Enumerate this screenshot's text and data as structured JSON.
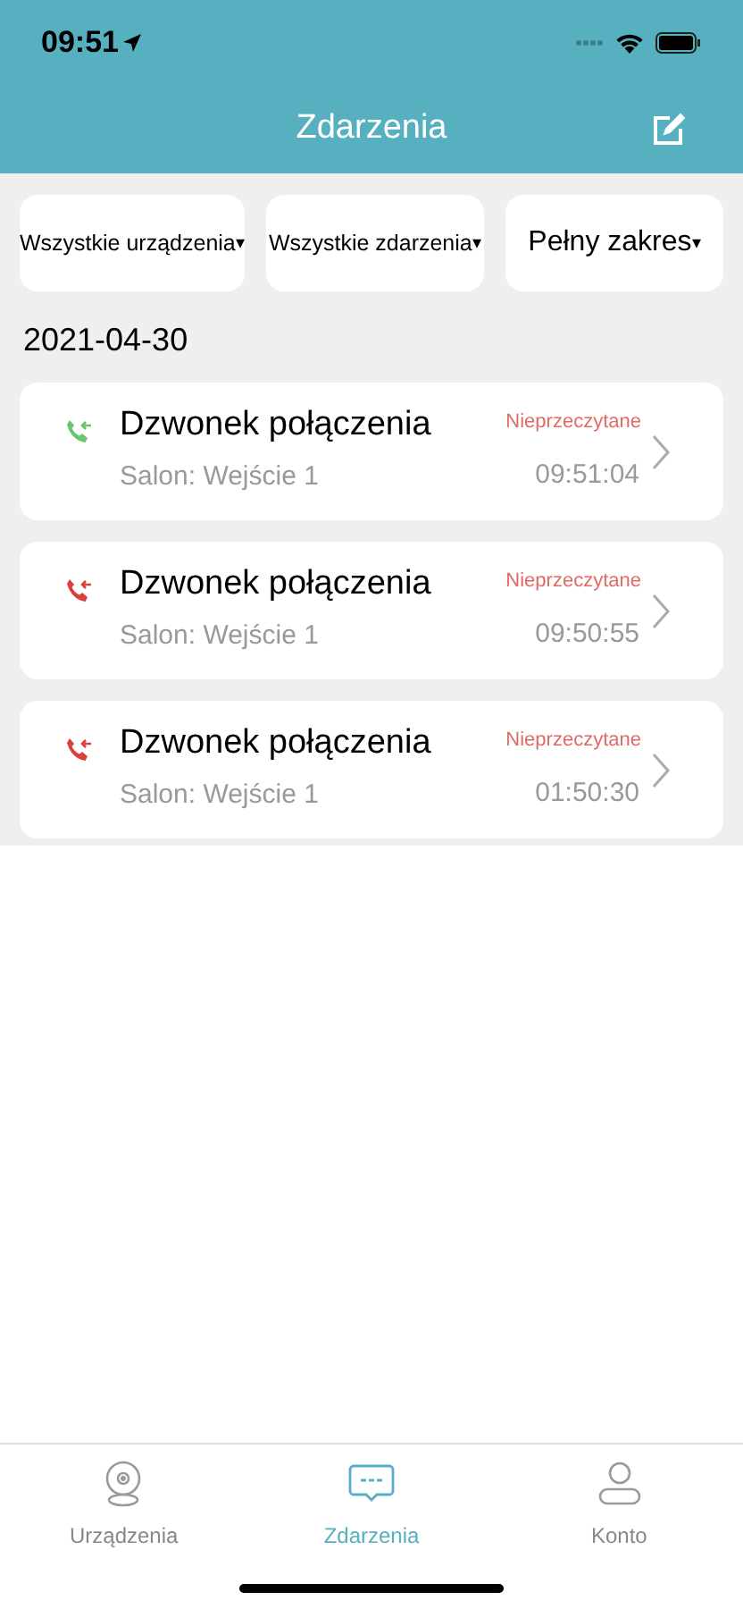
{
  "status_bar": {
    "time": "09:51"
  },
  "header": {
    "title": "Zdarzenia"
  },
  "filters": [
    "Wszystkie urządzenia",
    "Wszystkie zdarzenia",
    "Pełny zakres"
  ],
  "dropdown_caret": "▾",
  "date": "2021-04-30",
  "events": [
    {
      "title": "Dzwonek połączenia",
      "subtitle": "Salon: Wejście 1",
      "status": "Nieprzeczytane",
      "time": "09:51:04",
      "color": "#6cc46f"
    },
    {
      "title": "Dzwonek połączenia",
      "subtitle": "Salon: Wejście 1",
      "status": "Nieprzeczytane",
      "time": "09:50:55",
      "color": "#d9413f"
    },
    {
      "title": "Dzwonek połączenia",
      "subtitle": "Salon: Wejście 1",
      "status": "Nieprzeczytane",
      "time": "01:50:30",
      "color": "#d9413f"
    }
  ],
  "tab_bar": [
    {
      "label": "Urządzenia",
      "kind": "camera",
      "selected": false
    },
    {
      "label": "Zdarzenia",
      "kind": "messages",
      "selected": true
    },
    {
      "label": "Konto",
      "kind": "person",
      "selected": false
    }
  ]
}
